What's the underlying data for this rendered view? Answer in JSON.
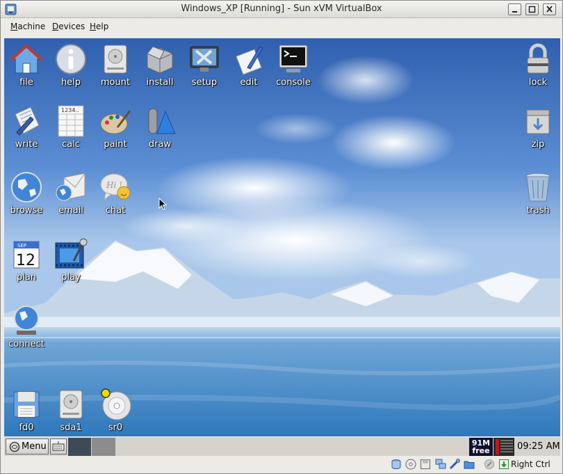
{
  "window": {
    "title": "Windows_XP [Running] - Sun xVM VirtualBox"
  },
  "menubar": {
    "items": [
      {
        "key": "M",
        "rest": "achine"
      },
      {
        "key": "D",
        "rest": "evices"
      },
      {
        "key": "H",
        "rest": "elp"
      }
    ]
  },
  "desktop": {
    "icons": {
      "file": "file",
      "help": "help",
      "mount": "mount",
      "install": "install",
      "setup": "setup",
      "edit": "edit",
      "console": "console",
      "lock": "lock",
      "write": "write",
      "calc": "calc",
      "paint": "paint",
      "draw": "draw",
      "zip": "zip",
      "browse": "browse",
      "email": "email",
      "chat": "chat",
      "trash": "trash",
      "plan": "plan",
      "play": "play",
      "connect": "connect",
      "fd0": "fd0",
      "sda1": "sda1",
      "sr0": "sr0"
    },
    "calendar": {
      "month": "SEP",
      "day": "12"
    },
    "calc_display": "1234..",
    "chat_text": "Hi !"
  },
  "taskbar": {
    "menu_label": "Menu",
    "memory_line1": "91M",
    "memory_line2": "free",
    "clock": "09:25 AM"
  },
  "statusbar": {
    "host_key": "Right Ctrl"
  },
  "colors": {
    "sky": "#4e7fc6",
    "water": "#3c7fbf",
    "taskbar": "#d6d3cc"
  }
}
